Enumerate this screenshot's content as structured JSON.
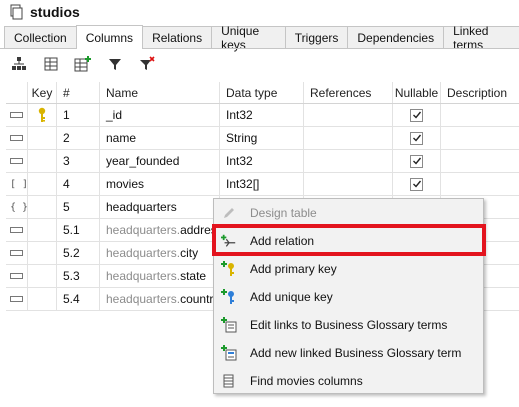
{
  "window": {
    "title": "studios"
  },
  "tabs": [
    {
      "label": "Collection"
    },
    {
      "label": "Columns"
    },
    {
      "label": "Relations"
    },
    {
      "label": "Unique keys"
    },
    {
      "label": "Triggers"
    },
    {
      "label": "Dependencies"
    },
    {
      "label": "Linked terms"
    }
  ],
  "active_tab": "Columns",
  "toolbar": {
    "icons": [
      "hierarchy-icon",
      "table-icon",
      "add-table-icon",
      "filter-icon",
      "clear-filter-icon"
    ]
  },
  "grid": {
    "headers": [
      "",
      "Key",
      "#",
      "Name",
      "Data type",
      "References",
      "Nullable",
      "Description"
    ],
    "rows": [
      {
        "row_icon": "field-icon",
        "key": true,
        "num": "1",
        "prefix": "",
        "name": "_id",
        "type": "Int32",
        "nullable": true
      },
      {
        "row_icon": "field-icon",
        "key": false,
        "num": "2",
        "prefix": "",
        "name": "name",
        "type": "String",
        "nullable": true
      },
      {
        "row_icon": "field-icon",
        "key": false,
        "num": "3",
        "prefix": "",
        "name": "year_founded",
        "type": "Int32",
        "nullable": true
      },
      {
        "row_icon": "array-icon",
        "row_icon_text": "[ ]",
        "key": false,
        "num": "4",
        "prefix": "",
        "name": "movies",
        "type": "Int32[]",
        "nullable": true
      },
      {
        "row_icon": "object-icon",
        "row_icon_text": "{ }",
        "key": false,
        "num": "5",
        "prefix": "",
        "name": "headquarters",
        "type": "",
        "nullable": false
      },
      {
        "row_icon": "field-icon",
        "key": false,
        "num": "5.1",
        "prefix": "headquarters.",
        "name": "address",
        "type": "",
        "nullable": false
      },
      {
        "row_icon": "field-icon",
        "key": false,
        "num": "5.2",
        "prefix": "headquarters.",
        "name": "city",
        "type": "",
        "nullable": false
      },
      {
        "row_icon": "field-icon",
        "key": false,
        "num": "5.3",
        "prefix": "headquarters.",
        "name": "state",
        "type": "",
        "nullable": false
      },
      {
        "row_icon": "field-icon",
        "key": false,
        "num": "5.4",
        "prefix": "headquarters.",
        "name": "country",
        "type": "",
        "nullable": false
      }
    ]
  },
  "context_menu": {
    "items": [
      {
        "label": "Design table",
        "icon": "pencil-icon",
        "disabled": true
      },
      {
        "label": "Add relation",
        "icon": "add-relation-icon",
        "disabled": false,
        "highlighted": true
      },
      {
        "label": "Add primary key",
        "icon": "add-primary-key-icon",
        "disabled": false
      },
      {
        "label": "Add unique key",
        "icon": "add-unique-key-icon",
        "disabled": false
      },
      {
        "label": "Edit links to Business Glossary terms",
        "icon": "edit-glossary-links-icon",
        "disabled": false
      },
      {
        "label": "Add new linked Business Glossary term",
        "icon": "add-glossary-term-icon",
        "disabled": false
      },
      {
        "label": "Find movies columns",
        "icon": "find-columns-icon",
        "disabled": false
      }
    ]
  },
  "colors": {
    "highlight_border": "#e3141e",
    "key_icon": "#d9b400",
    "unique_key_icon": "#2f7fd8",
    "add_green": "#1c9a2c"
  }
}
